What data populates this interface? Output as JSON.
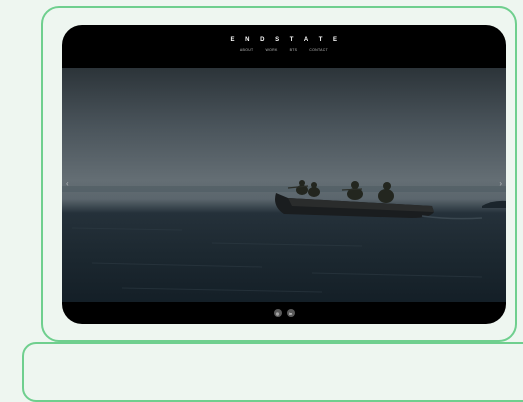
{
  "site": {
    "brand": "E N D  S T A T E",
    "nav": [
      "ABOUT",
      "WORK",
      "BTS",
      "CONTACT"
    ]
  },
  "slider": {
    "prev_glyph": "‹",
    "next_glyph": "›"
  },
  "footer": {
    "social": [
      {
        "icon": "instagram-icon",
        "glyph": "◎"
      },
      {
        "icon": "linkedin-icon",
        "glyph": "in"
      }
    ]
  },
  "colors": {
    "frame_border": "#6fcf8e",
    "page_background": "#eef6f0",
    "device_background": "#000000"
  }
}
